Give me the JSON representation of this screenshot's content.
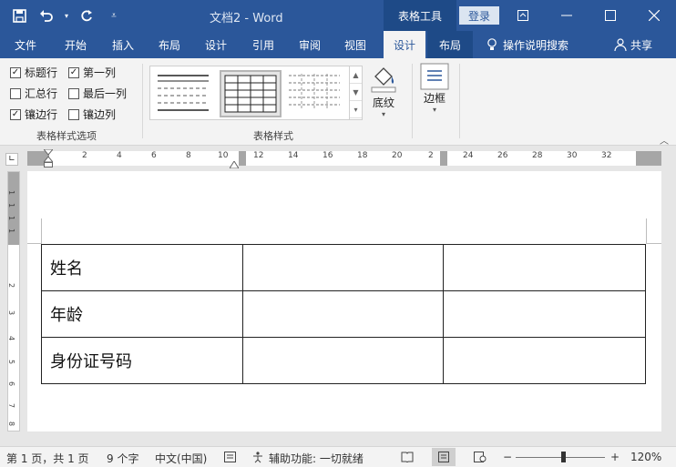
{
  "titlebar": {
    "doc_title": "文档2  -  Word",
    "context_tab": "表格工具",
    "login": "登录",
    "save_icon": "save-icon",
    "undo_icon": "undo-icon",
    "redo_icon": "redo-icon"
  },
  "tabs": [
    {
      "label": "文件"
    },
    {
      "label": "开始"
    },
    {
      "label": "插入"
    },
    {
      "label": "布局"
    },
    {
      "label": "设计"
    },
    {
      "label": "引用"
    },
    {
      "label": "审阅"
    },
    {
      "label": "视图"
    },
    {
      "label": "设计"
    },
    {
      "label": "布局"
    }
  ],
  "help_label": "操作说明搜索",
  "share_label": "共享",
  "ribbon": {
    "options": {
      "items": [
        {
          "label": "标题行",
          "checked": true
        },
        {
          "label": "第一列",
          "checked": true
        },
        {
          "label": "汇总行",
          "checked": false
        },
        {
          "label": "最后一列",
          "checked": false
        },
        {
          "label": "镶边行",
          "checked": true
        },
        {
          "label": "镶边列",
          "checked": false
        }
      ],
      "group_label": "表格样式选项"
    },
    "styles": {
      "group_label": "表格样式",
      "shading_label": "底纹"
    },
    "borders": {
      "label": "边框"
    }
  },
  "ruler": {
    "h_labels": [
      "2",
      "4",
      "6",
      "8",
      "10",
      "12",
      "14",
      "16",
      "18",
      "20",
      "2",
      "24",
      "26",
      "28",
      "30",
      "32"
    ],
    "v_labels": [
      "1",
      "1",
      "1",
      "1",
      "2",
      "3",
      "4",
      "5",
      "6",
      "7",
      "8"
    ]
  },
  "document": {
    "rows": [
      [
        "姓名",
        "",
        ""
      ],
      [
        "年龄",
        "",
        ""
      ],
      [
        "身份证号码",
        "",
        ""
      ]
    ]
  },
  "status": {
    "page": "第 1 页，共 1 页",
    "words": "9 个字",
    "language": "中文(中国)",
    "accessibility": "辅助功能: 一切就绪",
    "zoom": "120%"
  }
}
